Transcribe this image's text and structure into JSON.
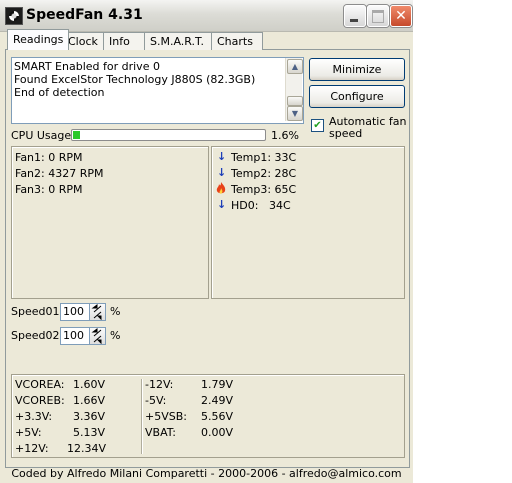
{
  "window": {
    "title": "SpeedFan 4.31",
    "close_glyph": "✕"
  },
  "tabs": [
    {
      "label": "Readings"
    },
    {
      "label": "Clock"
    },
    {
      "label": "Info"
    },
    {
      "label": "S.M.A.R.T."
    },
    {
      "label": "Charts"
    }
  ],
  "log": {
    "lines": [
      "SMART Enabled for drive 0",
      "Found ExcelStor Technology J880S (82.3GB)",
      "End of detection"
    ]
  },
  "buttons": {
    "minimize": "Minimize",
    "configure": "Configure"
  },
  "auto_fan": {
    "label": "Automatic fan speed",
    "checked": true
  },
  "cpu": {
    "label": "CPU Usage",
    "percent": 1.6,
    "percent_text": "1.6%",
    "fill_color": "#2bc82b"
  },
  "fans": [
    {
      "label": "Fan1:",
      "value": "0 RPM"
    },
    {
      "label": "Fan2:",
      "value": "4327 RPM"
    },
    {
      "label": "Fan3:",
      "value": "0 RPM"
    }
  ],
  "temps": [
    {
      "icon": "arrow-down-icon",
      "label": "Temp1:",
      "value": "33C"
    },
    {
      "icon": "arrow-down-icon",
      "label": "Temp2:",
      "value": "28C"
    },
    {
      "icon": "flame-icon",
      "label": "Temp3:",
      "value": "65C"
    },
    {
      "icon": "arrow-down-icon",
      "label": "HD0:",
      "value": "34C"
    }
  ],
  "speeds": [
    {
      "label": "Speed01:",
      "value": "100",
      "unit": "%"
    },
    {
      "label": "Speed02:",
      "value": "100",
      "unit": "%"
    }
  ],
  "voltages_left": [
    {
      "label": "VCOREA:",
      "value": "1.60V"
    },
    {
      "label": "VCOREB:",
      "value": "1.66V"
    },
    {
      "label": "+3.3V:",
      "value": "3.36V"
    },
    {
      "label": "+5V:",
      "value": "5.13V"
    },
    {
      "label": "+12V:",
      "value": "12.34V"
    }
  ],
  "voltages_right": [
    {
      "label": "-12V:",
      "value": "1.79V"
    },
    {
      "label": "-5V:",
      "value": "2.49V"
    },
    {
      "label": "+5VSB:",
      "value": "5.56V"
    },
    {
      "label": "VBAT:",
      "value": "0.00V"
    }
  ],
  "footer": "Coded by Alfredo Milani Comparetti - 2000-2006 - alfredo@almico.com",
  "colors": {
    "arrow": "#1d3fb8",
    "flame": "#e8421a"
  }
}
